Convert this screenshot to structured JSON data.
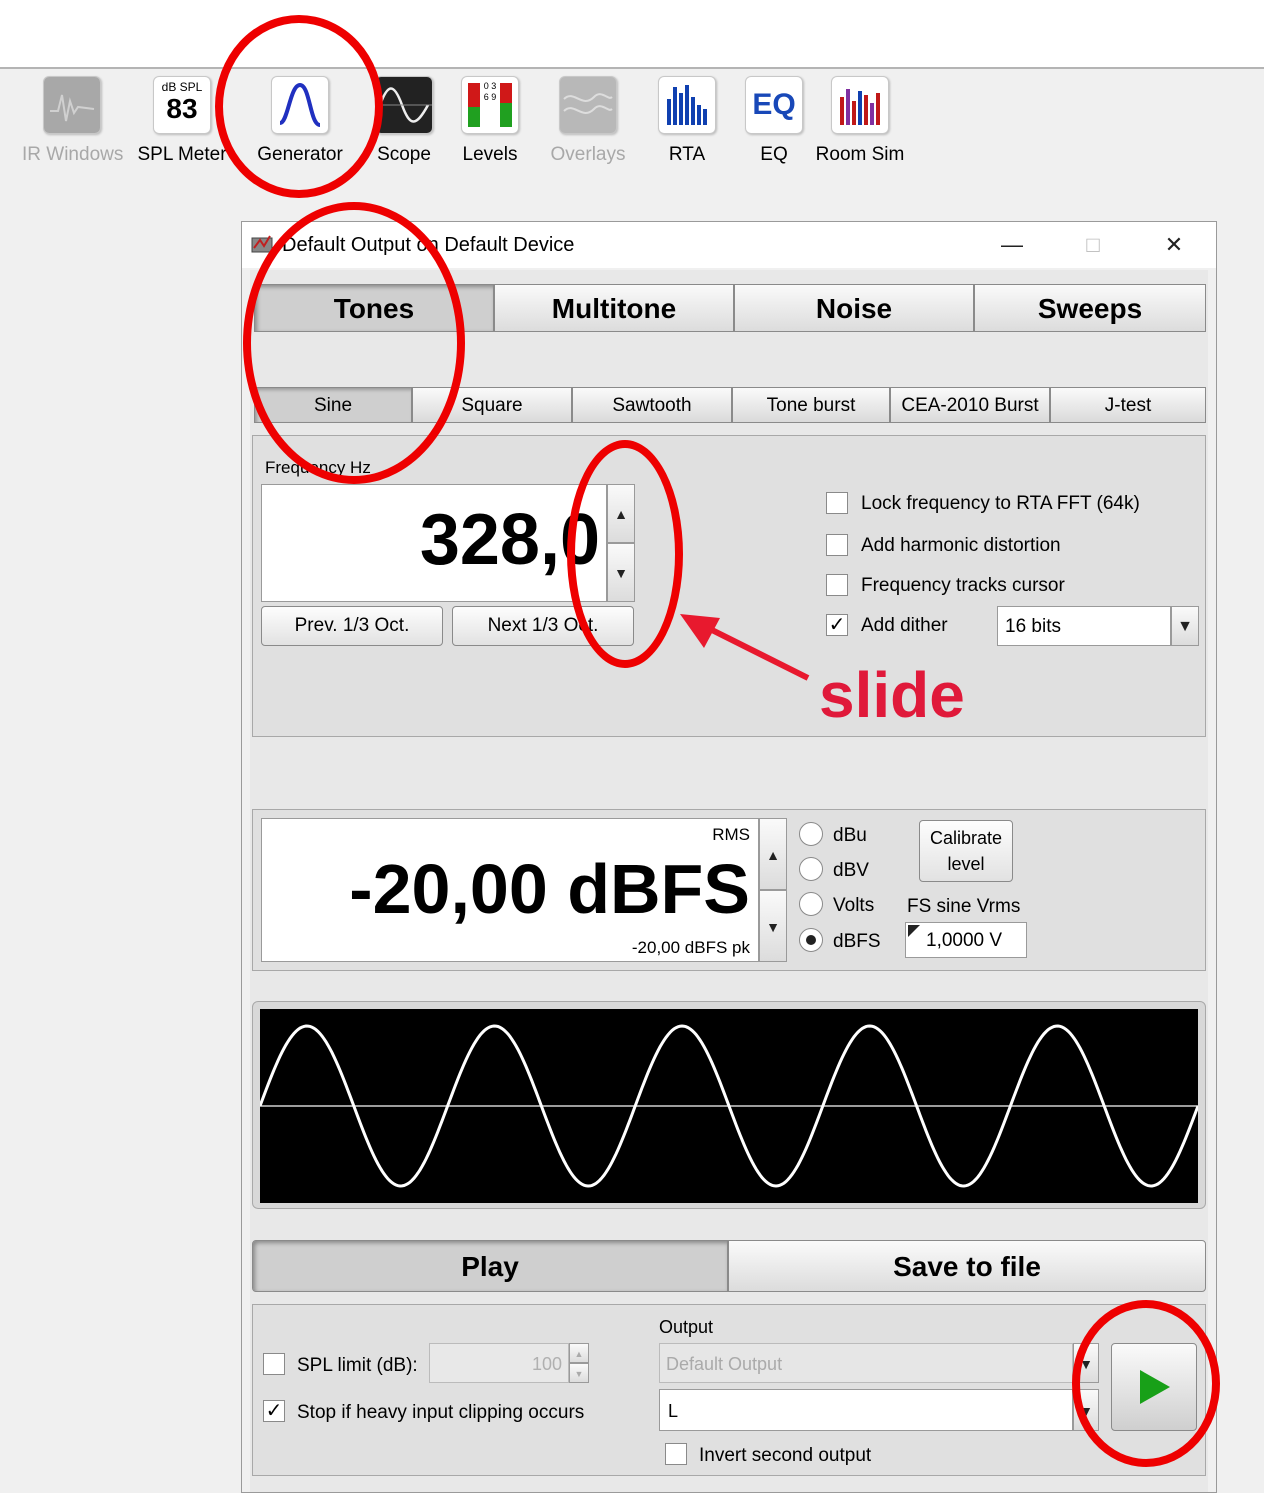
{
  "toolbar": {
    "items": [
      {
        "label": "IR Windows",
        "icon": "ir-windows-icon",
        "disabled": true
      },
      {
        "label": "SPL Meter",
        "icon": "spl-meter-icon",
        "badge_top": "dB SPL",
        "badge_value": "83"
      },
      {
        "label": "Generator",
        "icon": "sine-wave-icon"
      },
      {
        "label": "Scope",
        "icon": "scope-icon"
      },
      {
        "label": "Levels",
        "icon": "levels-icon",
        "scale": "0 3 6 9"
      },
      {
        "label": "Overlays",
        "icon": "overlays-icon",
        "disabled": true
      },
      {
        "label": "RTA",
        "icon": "rta-icon"
      },
      {
        "label": "EQ",
        "icon": "eq-icon",
        "text": "EQ"
      },
      {
        "label": "Room Sim",
        "icon": "room-sim-icon"
      }
    ]
  },
  "window": {
    "title": "Default Output on Default Device",
    "minimize": "—",
    "maximize": "□",
    "close": "✕"
  },
  "tabs": [
    {
      "label": "Tones",
      "selected": true
    },
    {
      "label": "Multitone"
    },
    {
      "label": "Noise"
    },
    {
      "label": "Sweeps"
    }
  ],
  "subtabs": [
    {
      "label": "Sine",
      "selected": true
    },
    {
      "label": "Square"
    },
    {
      "label": "Sawtooth"
    },
    {
      "label": "Tone burst"
    },
    {
      "label": "CEA-2010 Burst"
    },
    {
      "label": "J-test"
    }
  ],
  "frequency": {
    "label": "Frequency Hz",
    "value": "328,0",
    "prev_button": "Prev. 1/3 Oct.",
    "next_button": "Next 1/3 Oct."
  },
  "options": {
    "lock_fft": {
      "label": "Lock frequency to RTA FFT (64k)",
      "checked": false
    },
    "harmonic": {
      "label": "Add harmonic distortion",
      "checked": false
    },
    "tracks": {
      "label": "Frequency tracks cursor",
      "checked": false
    },
    "dither": {
      "label": "Add dither",
      "checked": true,
      "value": "16 bits"
    }
  },
  "level": {
    "rms_label": "RMS",
    "value": "-20,00 dBFS",
    "peak": "-20,00 dBFS pk",
    "units": [
      "dBu",
      "dBV",
      "Volts",
      "dBFS"
    ],
    "selected_unit": "dBFS",
    "calibrate_line1": "Calibrate",
    "calibrate_line2": "level",
    "fs_label": "FS sine Vrms",
    "fs_value": "1,0000 V"
  },
  "waveform": {
    "cycles": 5,
    "background": "#000000",
    "trace": "#ffffff"
  },
  "actions": {
    "play": "Play",
    "save": "Save to file"
  },
  "bottom": {
    "spl_limit_label": "SPL limit (dB):",
    "spl_limit_value": "100",
    "stop_clip_label": "Stop if heavy input clipping occurs",
    "output_label": "Output",
    "output_device": "Default Output",
    "output_channel": "L",
    "invert_label": "Invert second output"
  },
  "annotation": {
    "text": "slide",
    "color": "#e0193a",
    "ring_color": "#ee0000"
  }
}
